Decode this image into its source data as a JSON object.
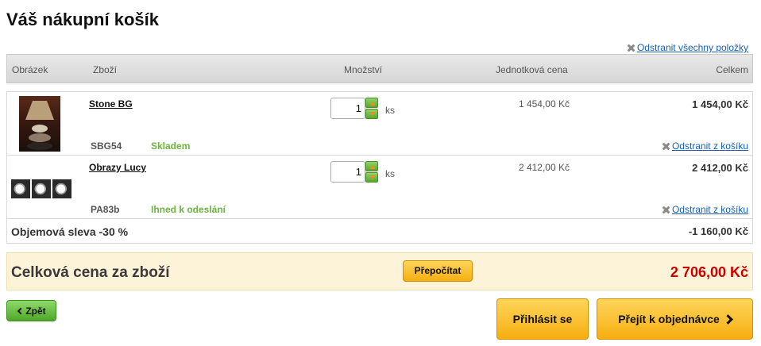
{
  "page": {
    "title": "Váš nákupní košík"
  },
  "actions": {
    "remove_all": "Odstranit všechny položky"
  },
  "columns": {
    "image": "Obrázek",
    "product": "Zboží",
    "quantity": "Množství",
    "unit_price": "Jednotková cena",
    "total": "Celkem"
  },
  "items": [
    {
      "name": "Stone BG",
      "code": "SBG54",
      "availability": "Skladem",
      "quantity": "1",
      "unit": "ks",
      "unit_price": "1 454,00 Kč",
      "total": "1 454,00 Kč",
      "remove": "Odstranit z košíku"
    },
    {
      "name": "Obrazy Lucy",
      "code": "PA83b",
      "availability": "Ihned k odeslání",
      "quantity": "1",
      "unit": "ks",
      "unit_price": "2 412,00 Kč",
      "total": "2 412,00 Kč",
      "remove": "Odstranit z košíku"
    }
  ],
  "discount": {
    "label": "Objemová sleva -30 %",
    "value": "-1 160,00 Kč"
  },
  "summary": {
    "label": "Celková cena za zboží",
    "recalc": "Přepočítat",
    "total": "2 706,00 Kč"
  },
  "nav": {
    "back": "Zpět",
    "login": "Přihlásit se",
    "checkout": "Přejít k objednávce"
  },
  "colors": {
    "accent": "#f6ae10",
    "price_total": "#cc0000",
    "stock": "#6cb33f",
    "link": "#1a5fb4"
  }
}
